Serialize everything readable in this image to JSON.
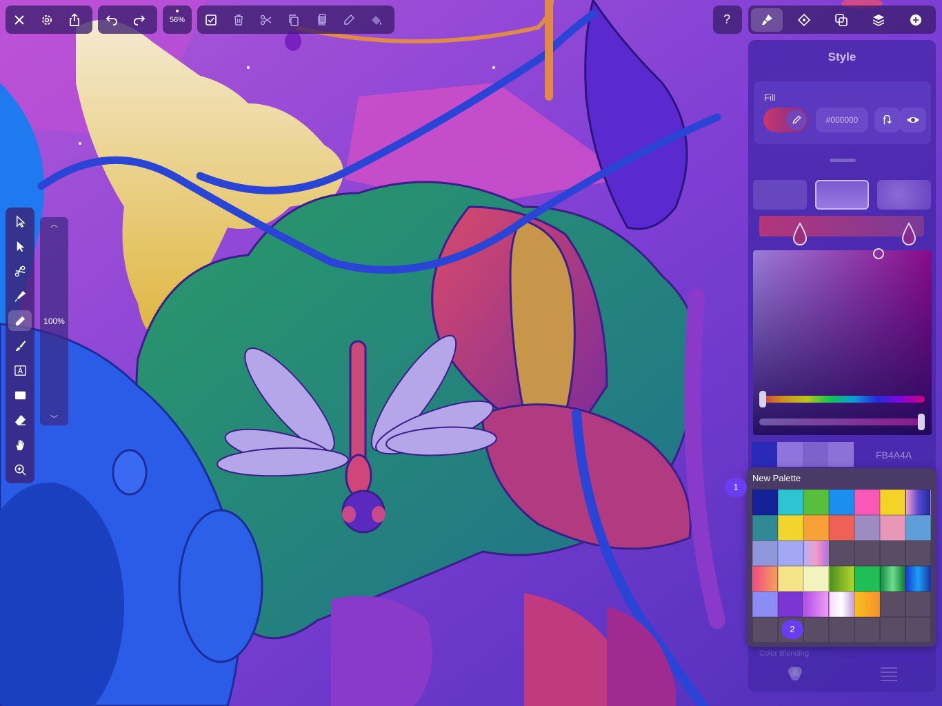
{
  "toolbar": {
    "zoom_label": "56%"
  },
  "tools": [
    {
      "name": "select-tool",
      "icon": "arrow-icon"
    },
    {
      "name": "node-tool",
      "icon": "node-arrow-icon"
    },
    {
      "name": "scissors-tool",
      "icon": "scissors-icon"
    },
    {
      "name": "pen-tool",
      "icon": "pen-icon"
    },
    {
      "name": "pencil-tool",
      "icon": "pencil-icon"
    },
    {
      "name": "brush-tool",
      "icon": "brush-icon"
    },
    {
      "name": "text-tool",
      "icon": "text-icon"
    },
    {
      "name": "shape-tool",
      "icon": "rectangle-icon"
    },
    {
      "name": "eraser-tool",
      "icon": "eraser-icon"
    },
    {
      "name": "hand-tool",
      "icon": "hand-icon"
    },
    {
      "name": "zoom-tool",
      "icon": "zoom-icon"
    }
  ],
  "brush_slider": {
    "value_label": "100%"
  },
  "right_tabs": [
    "style-tab",
    "vector-tab",
    "boolean-tab",
    "layers-tab",
    "add-tab"
  ],
  "help_label": "?",
  "style_panel": {
    "title": "Style",
    "fill_label": "Fill",
    "fill_hex": "#000000",
    "current_hex": "FB4A4A",
    "footer_label": "Color Blending"
  },
  "palette": {
    "title": "New Palette",
    "badge_1": "1",
    "badge_2": "2",
    "colors": [
      "#14229a",
      "#2ec5d2",
      "#58bf3c",
      "#1b8fef",
      "#fa58b8",
      "#f3d327",
      "linear-gradient(90deg,#f7a0c8,#5a4ad0,#1c2a9a)",
      "#2f8a96",
      "#f2d52c",
      "#f8a139",
      "#ed6156",
      "#9d8cc2",
      "#e698b6",
      "#5f9ed9",
      "#8f96d9",
      "#a3a8f2",
      "linear-gradient(90deg,#b8b0f2,#f39bc6,#b470e0)",
      "#5b4c65",
      "#5b4c65",
      "#5b4c65",
      "#5b4c65",
      "linear-gradient(90deg,#f34a85,#f2a25a)",
      "#f6e48a",
      "#f2f4c0",
      "linear-gradient(90deg,#4b8f1f,#b2d82a)",
      "#1fbf55",
      "linear-gradient(90deg,#1a8a4a,#6be08a,#137a39)",
      "linear-gradient(90deg,#1e3ad8,#1aa0f0,#173aa6)",
      "#8b8cf6",
      "#7a35d2",
      "linear-gradient(90deg,#b14ee8,#ef9ef2)",
      "linear-gradient(90deg,#f6dcf5,#ffffff,#c6a2d8)",
      "linear-gradient(90deg,#f6c21b,#f7902d)",
      "#5b4c65",
      "#5b4c65",
      "#5b4c65",
      "#5b4c65",
      "#5b4c65",
      "#5b4c65",
      "#5b4c65",
      "#5b4c65",
      "#5b4c65"
    ]
  }
}
